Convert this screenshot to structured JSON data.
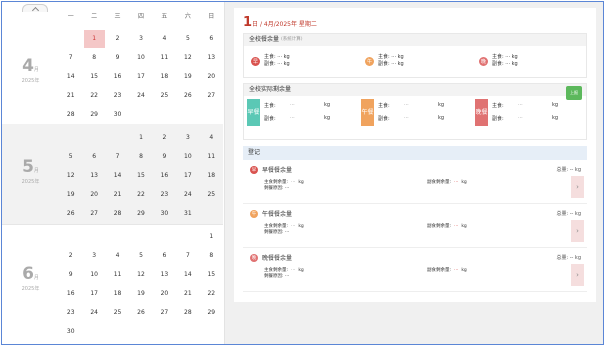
{
  "calendar": {
    "weekdays": [
      "一",
      "二",
      "三",
      "四",
      "五",
      "六",
      "日"
    ],
    "months": [
      {
        "num": "4",
        "suffix": "月",
        "year": "2025年",
        "days": [
          "",
          "1",
          "2",
          "3",
          "4",
          "5",
          "6",
          "7",
          "8",
          "9",
          "10",
          "11",
          "12",
          "13",
          "14",
          "15",
          "16",
          "17",
          "18",
          "19",
          "20",
          "21",
          "22",
          "23",
          "24",
          "25",
          "26",
          "27",
          "28",
          "29",
          "30"
        ],
        "today": "1"
      },
      {
        "num": "5",
        "suffix": "月",
        "year": "2025年",
        "days": [
          "",
          "",
          "",
          "1",
          "2",
          "3",
          "4",
          "5",
          "6",
          "7",
          "8",
          "9",
          "10",
          "11",
          "12",
          "13",
          "14",
          "15",
          "16",
          "17",
          "18",
          "19",
          "20",
          "21",
          "22",
          "23",
          "24",
          "25",
          "26",
          "27",
          "28",
          "29",
          "30",
          "31"
        ]
      },
      {
        "num": "6",
        "suffix": "月",
        "year": "2025年",
        "days": [
          "",
          "",
          "",
          "",
          "",
          "",
          "1",
          "2",
          "3",
          "4",
          "5",
          "6",
          "7",
          "8",
          "9",
          "10",
          "11",
          "12",
          "13",
          "14",
          "15",
          "16",
          "17",
          "18",
          "19",
          "20",
          "21",
          "22",
          "23",
          "24",
          "25",
          "26",
          "27",
          "28",
          "29",
          "30"
        ]
      }
    ]
  },
  "header": {
    "day": "1",
    "rest": "日 / 4月/2025年 星期二"
  },
  "school_total": {
    "title": "全校餐余量",
    "subtitle": "(系统计算)",
    "items": [
      {
        "icon": "早",
        "color": "#d9534f",
        "staple": "主食: ··· kg",
        "side": "副食: ··· kg"
      },
      {
        "icon": "午",
        "color": "#f0a35e",
        "staple": "主食: ··· kg",
        "side": "副食: ··· kg"
      },
      {
        "icon": "晚",
        "color": "#e07272",
        "staple": "主食: ··· kg",
        "side": "副食: ··· kg"
      }
    ]
  },
  "school_remain": {
    "title": "全校实际剩余量",
    "button": "上报",
    "items": [
      {
        "tag": "早餐",
        "color": "#5bc8b5",
        "staple_k": "主食:",
        "side_k": "副食:",
        "val": "···",
        "unit": "kg"
      },
      {
        "tag": "午餐",
        "color": "#f0a35e",
        "staple_k": "主食:",
        "side_k": "副食:",
        "val": "···",
        "unit": "kg"
      },
      {
        "tag": "晚餐",
        "color": "#e07272",
        "staple_k": "主食:",
        "side_k": "副食:",
        "val": "···",
        "unit": "kg"
      }
    ]
  },
  "register": {
    "title": "登记",
    "meals": [
      {
        "icon": "早",
        "color": "#d9534f",
        "name": "早餐餐余量",
        "total": "总量: -- kg",
        "staple": "主食剩余量:",
        "staple_val": "···",
        "unit": "kg",
        "side": "副食剩余量:",
        "side_val": "···",
        "side_unit": "kg",
        "reason": "剩餐原因: ···"
      },
      {
        "icon": "午",
        "color": "#f0a35e",
        "name": "午餐餐余量",
        "total": "总量: -- kg",
        "staple": "主食剩余量:",
        "staple_val": "···",
        "unit": "kg",
        "side": "副食剩余量:",
        "side_val": "···",
        "side_unit": "kg",
        "reason": "剩餐原因: ···"
      },
      {
        "icon": "晚",
        "color": "#e07272",
        "name": "晚餐餐余量",
        "total": "总量: -- kg",
        "staple": "主食剩余量:",
        "staple_val": "···",
        "unit": "kg",
        "side": "副食剩余量:",
        "side_val": "···",
        "side_unit": "kg",
        "reason": "剩餐原因: ···"
      }
    ]
  }
}
